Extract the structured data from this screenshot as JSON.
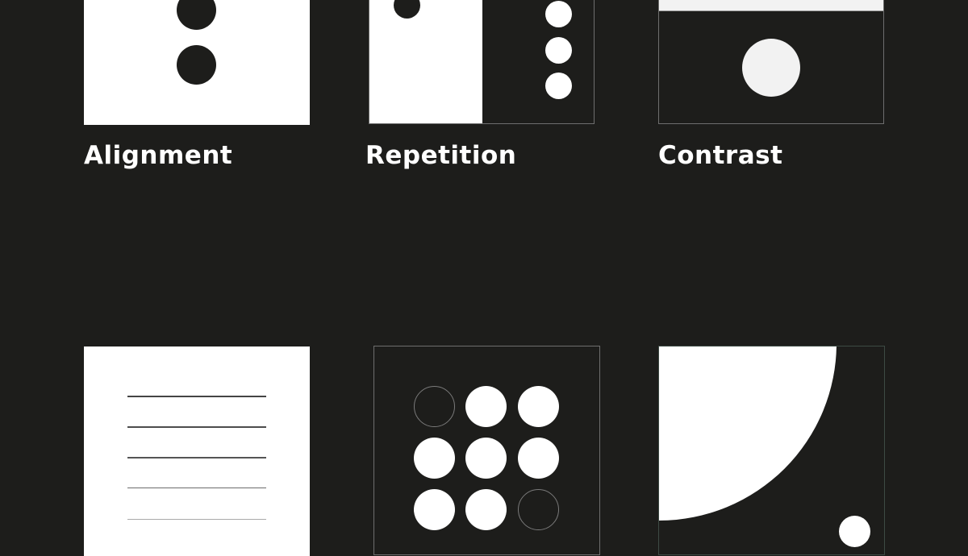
{
  "background_color": "#1d1d1b",
  "panels": [
    {
      "id": "alignment",
      "label": "Alignment"
    },
    {
      "id": "repetition",
      "label": "Repetition"
    },
    {
      "id": "contrast",
      "label": "Contrast"
    },
    {
      "id": "hierarchy",
      "label": ""
    },
    {
      "id": "pattern",
      "label": ""
    },
    {
      "id": "balance",
      "label": ""
    }
  ],
  "grid_circles": [
    "outline",
    "filled",
    "filled",
    "filled",
    "filled",
    "filled",
    "filled",
    "filled",
    "outline"
  ],
  "colors": {
    "light": "#ffffff",
    "dark": "#1d1d1b",
    "border": "#6e6e6e"
  }
}
